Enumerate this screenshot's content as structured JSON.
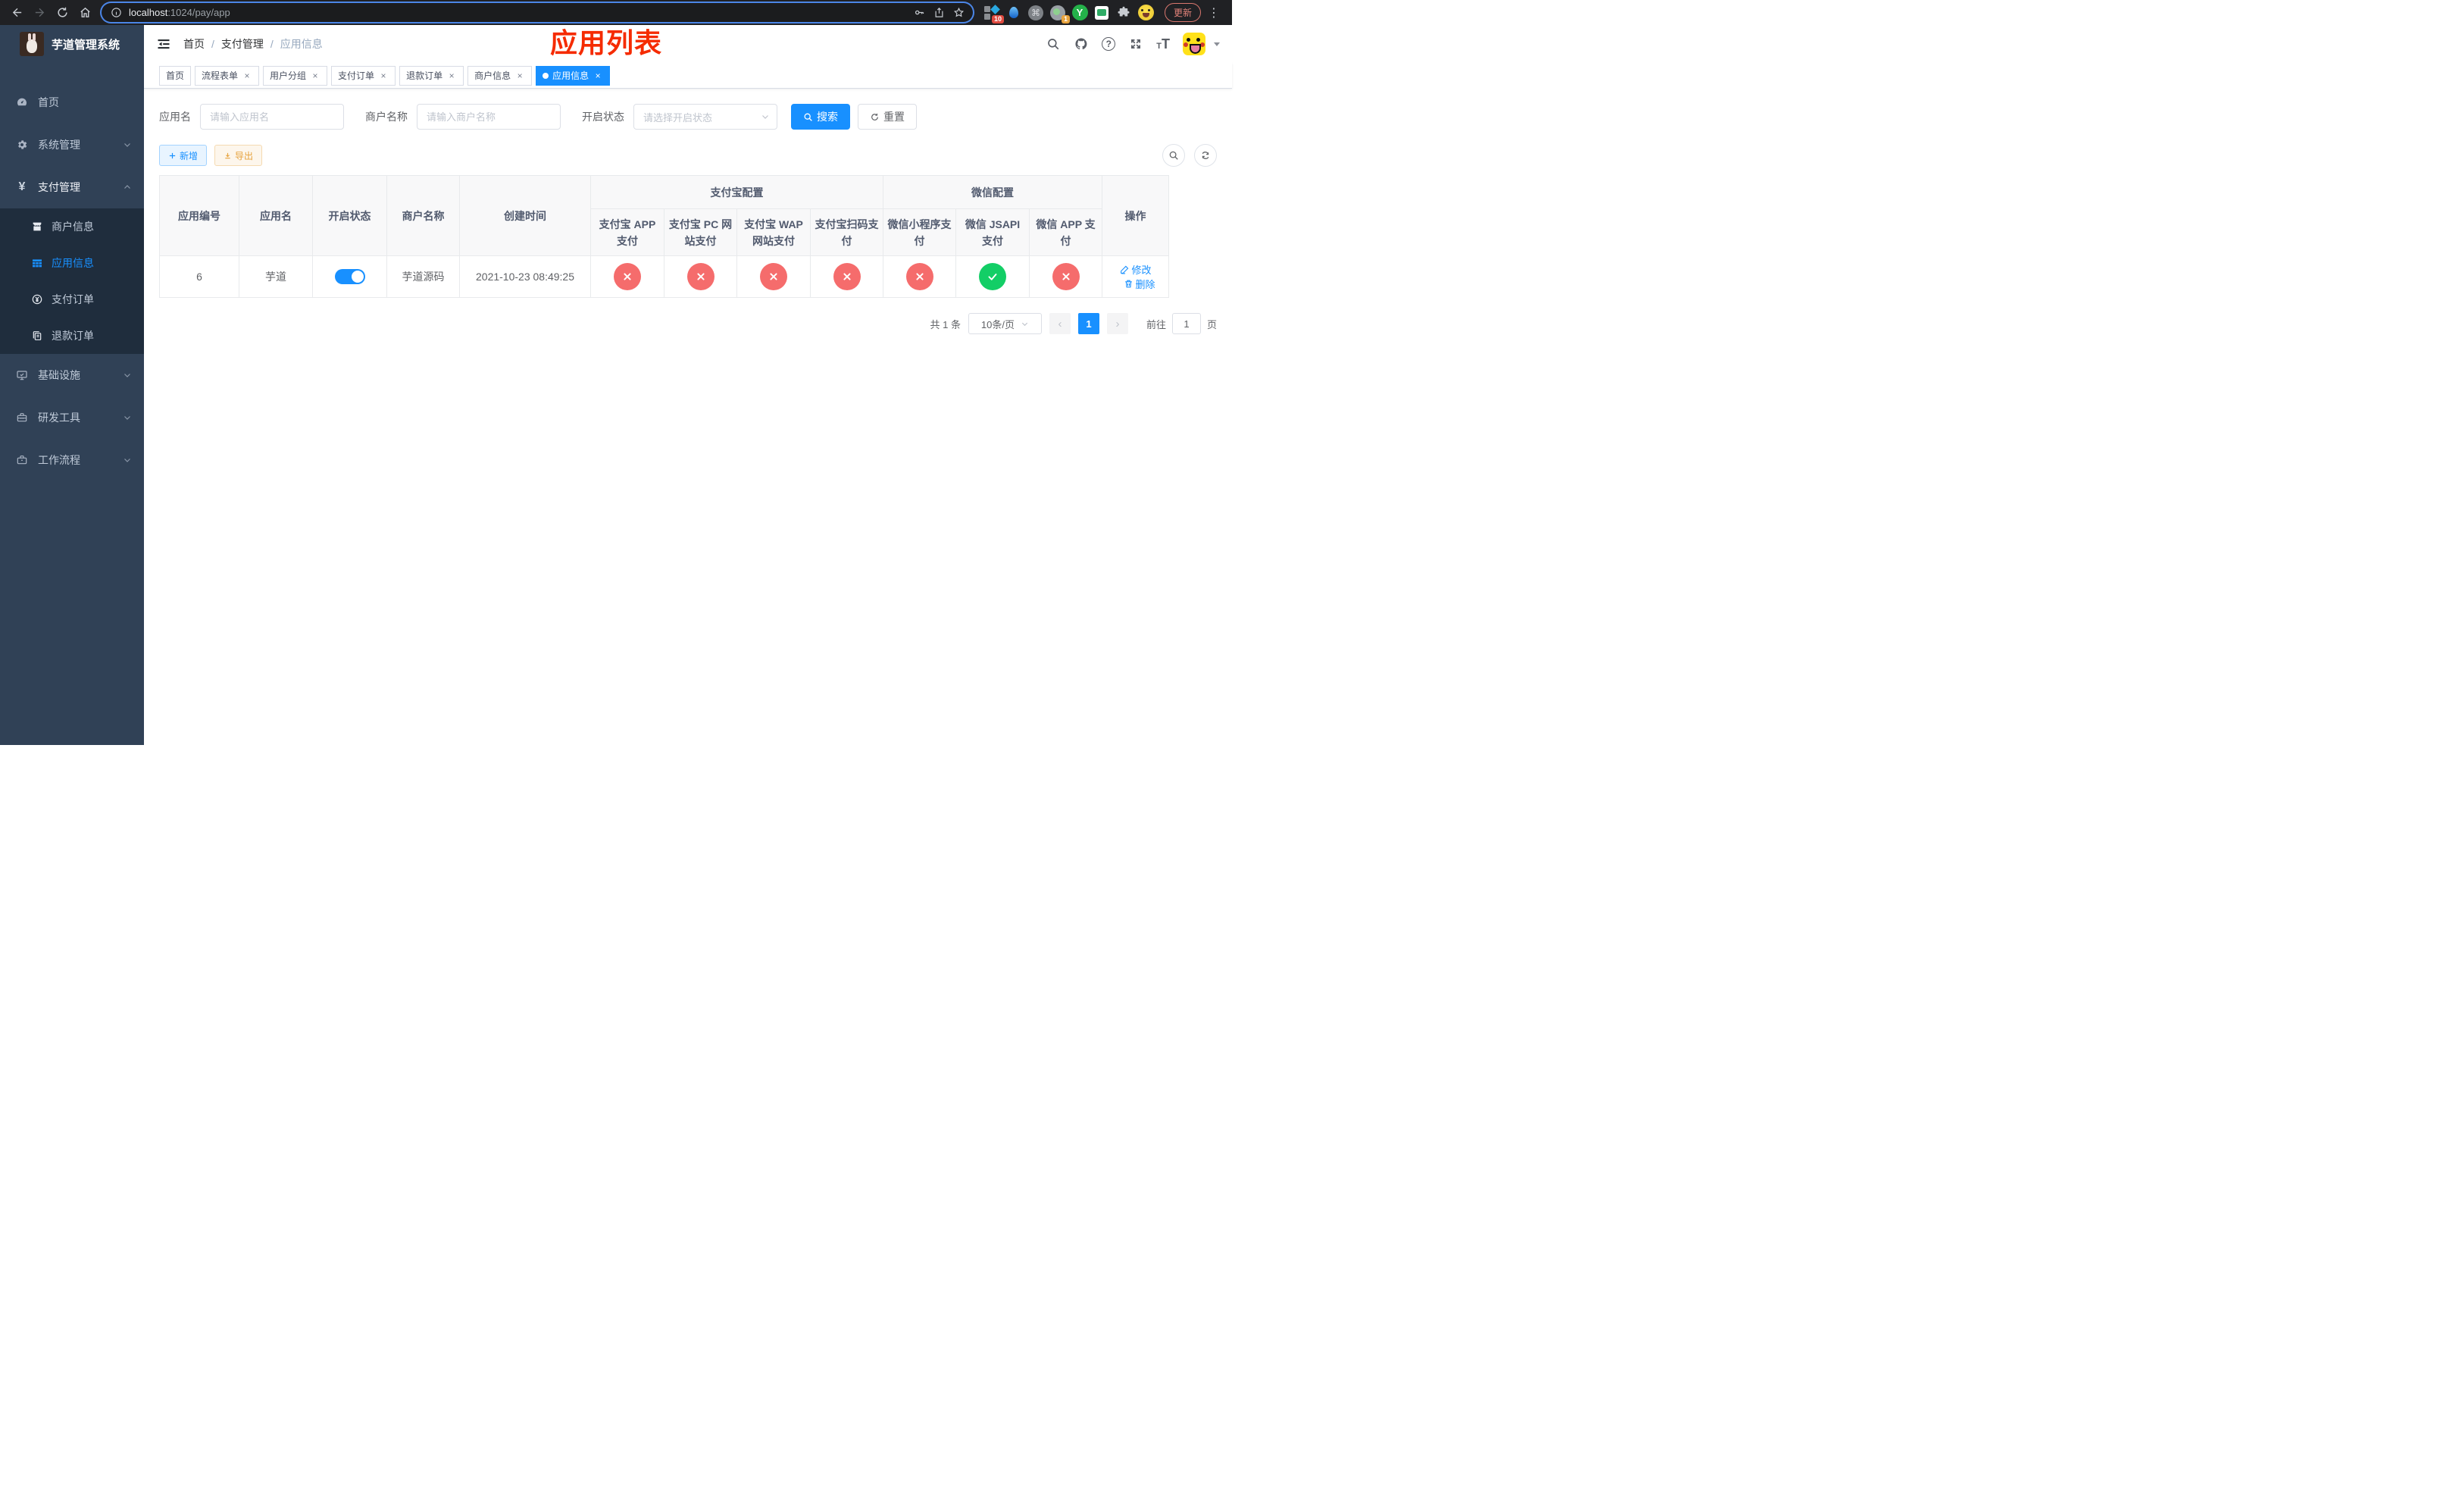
{
  "browser": {
    "url_host": "localhost",
    "url_path": ":1024/pay/app",
    "badge_10": "10",
    "badge_1": "1",
    "ext_y_label": "Y",
    "cmd_glyph": "⌘",
    "update_button": "更新",
    "dots_glyph": "⋮"
  },
  "sidebar": {
    "app_title": "芋道管理系统",
    "yen_glyph": "¥",
    "menu": {
      "home": "首页",
      "system": "系统管理",
      "payment": "支付管理",
      "merchant_info": "商户信息",
      "app_info": "应用信息",
      "pay_order": "支付订单",
      "refund_order": "退款订单",
      "infrastructure": "基础设施",
      "dev_tools": "研发工具",
      "workflow": "工作流程"
    }
  },
  "header": {
    "breadcrumb": [
      "首页",
      "支付管理",
      "应用信息"
    ],
    "separator": "/",
    "overlay_title": "应用列表",
    "question_glyph": "?",
    "font_small": "T",
    "font_big": "T"
  },
  "tabs": [
    {
      "label": "首页"
    },
    {
      "label": "流程表单"
    },
    {
      "label": "用户分组"
    },
    {
      "label": "支付订单"
    },
    {
      "label": "退款订单"
    },
    {
      "label": "商户信息"
    },
    {
      "label": "应用信息"
    }
  ],
  "close_glyph": "×",
  "filters": {
    "app_name_label": "应用名",
    "app_name_placeholder": "请输入应用名",
    "merchant_label": "商户名称",
    "merchant_placeholder": "请输入商户名称",
    "status_label": "开启状态",
    "status_placeholder": "请选择开启状态",
    "search_button": "搜索",
    "reset_button": "重置"
  },
  "toolbar": {
    "add_button": "新增",
    "export_button": "导出"
  },
  "table": {
    "col_id": "应用编号",
    "col_name": "应用名",
    "col_status": "开启状态",
    "col_merchant": "商户名称",
    "col_created": "创建时间",
    "group_alipay": "支付宝配置",
    "group_wechat": "微信配置",
    "col_actions": "操作",
    "pay_cols": [
      "支付宝 APP 支付",
      "支付宝 PC 网站支付",
      "支付宝 WAP 网站支付",
      "支付宝扫码支付",
      "微信小程序支付",
      "微信 JSAPI 支付",
      "微信 APP 支付"
    ],
    "row": {
      "id": "6",
      "name": "芋道",
      "enabled": true,
      "merchant": "芋道源码",
      "created": "2021-10-23 08:49:25",
      "pay_status": [
        false,
        false,
        false,
        false,
        false,
        true,
        false
      ],
      "edit_label": "修改",
      "delete_label": "删除"
    }
  },
  "pagination": {
    "total": "共 1 条",
    "page_size": "10条/页",
    "prev_glyph": "‹",
    "next_glyph": "›",
    "page": "1",
    "goto_label": "前往",
    "goto_value": "1",
    "unit": "页"
  },
  "colors": {
    "primary": "#1890ff",
    "success": "#13ce66",
    "danger": "#f56c6c",
    "sidebar_bg": "#304156",
    "submenu_bg": "#1f2d3d",
    "annotation": "#f52b00"
  }
}
